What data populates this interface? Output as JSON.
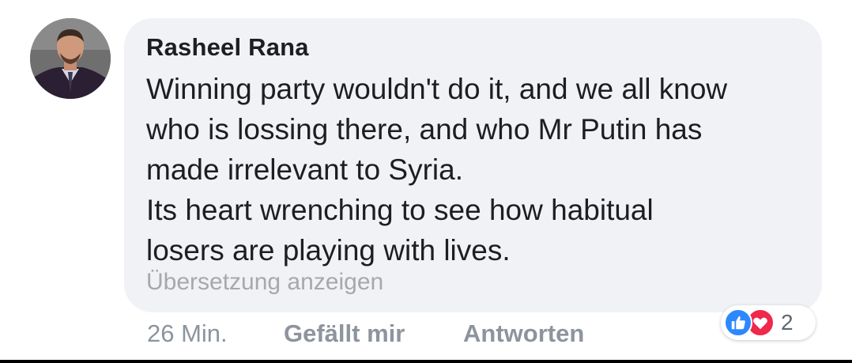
{
  "comment": {
    "author": "Rasheel Rana",
    "lines": [
      "Winning party wouldn't do it, and we all know",
      "who is lossing there, and who Mr Putin has",
      "made irrelevant to Syria.",
      "Its heart wrenching to see how habitual",
      "losers are playing with lives."
    ],
    "translate_label": "Übersetzung anzeigen"
  },
  "actions": {
    "time": "26 Min.",
    "like_label": "Gefällt mir",
    "reply_label": "Antworten"
  },
  "reactions": {
    "count": "2",
    "icons": [
      "like-icon",
      "love-icon"
    ],
    "like_color": "#2d88ff",
    "love_color": "#f0284a"
  },
  "colors": {
    "bubble": "#f1f2f6",
    "text": "#1c1e21",
    "muted": "#8d949e"
  }
}
